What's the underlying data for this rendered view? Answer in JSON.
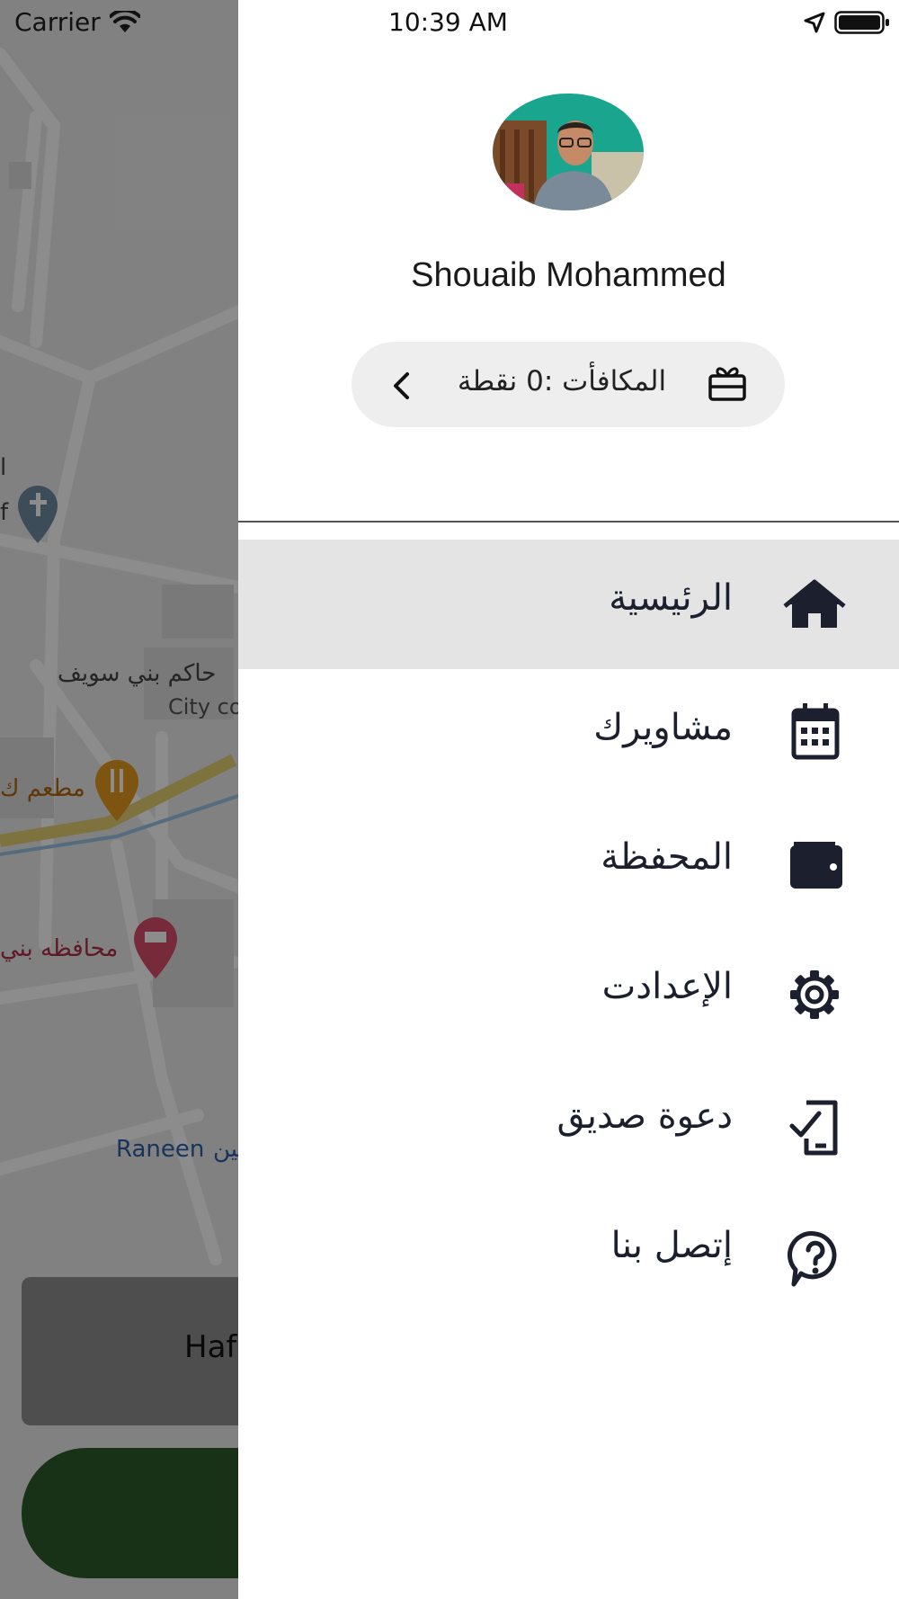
{
  "status_bar": {
    "carrier": "Carrier",
    "time": "10:39 AM"
  },
  "map": {
    "labels": {
      "governorate_cut": "حاكم بني سويف",
      "city_cut": "City co",
      "restaurant_cut": "مطعم ك",
      "hotel_cut": "محافظه بني",
      "raneen": "Raneen",
      "raneen_ar_cut": "رنين",
      "left_edge_1": "l",
      "left_edge_2": "f"
    }
  },
  "behind_drawer": {
    "destination_text": "Haf"
  },
  "drawer": {
    "user_name": "Shouaib Mohammed",
    "rewards_label": "المكافأت :0 نقطة",
    "menu": [
      {
        "label": "الرئيسية",
        "icon": "home-icon",
        "active": true
      },
      {
        "label": "مشاويرك",
        "icon": "calendar-icon",
        "active": false
      },
      {
        "label": "المحفظة",
        "icon": "wallet-icon",
        "active": false
      },
      {
        "label": "الإعدادت",
        "icon": "gear-icon",
        "active": false
      },
      {
        "label": "دعوة صديق",
        "icon": "invite-device-icon",
        "active": false
      },
      {
        "label": "إتصل بنا",
        "icon": "help-icon",
        "active": false
      }
    ]
  },
  "colors": {
    "drawer_bg": "#ffffff",
    "active_item_bg": "#e4e4e4",
    "rewards_pill_bg": "#eeeeee",
    "menu_text": "#1b1f2e",
    "primary_button": "#2a5b2a"
  }
}
